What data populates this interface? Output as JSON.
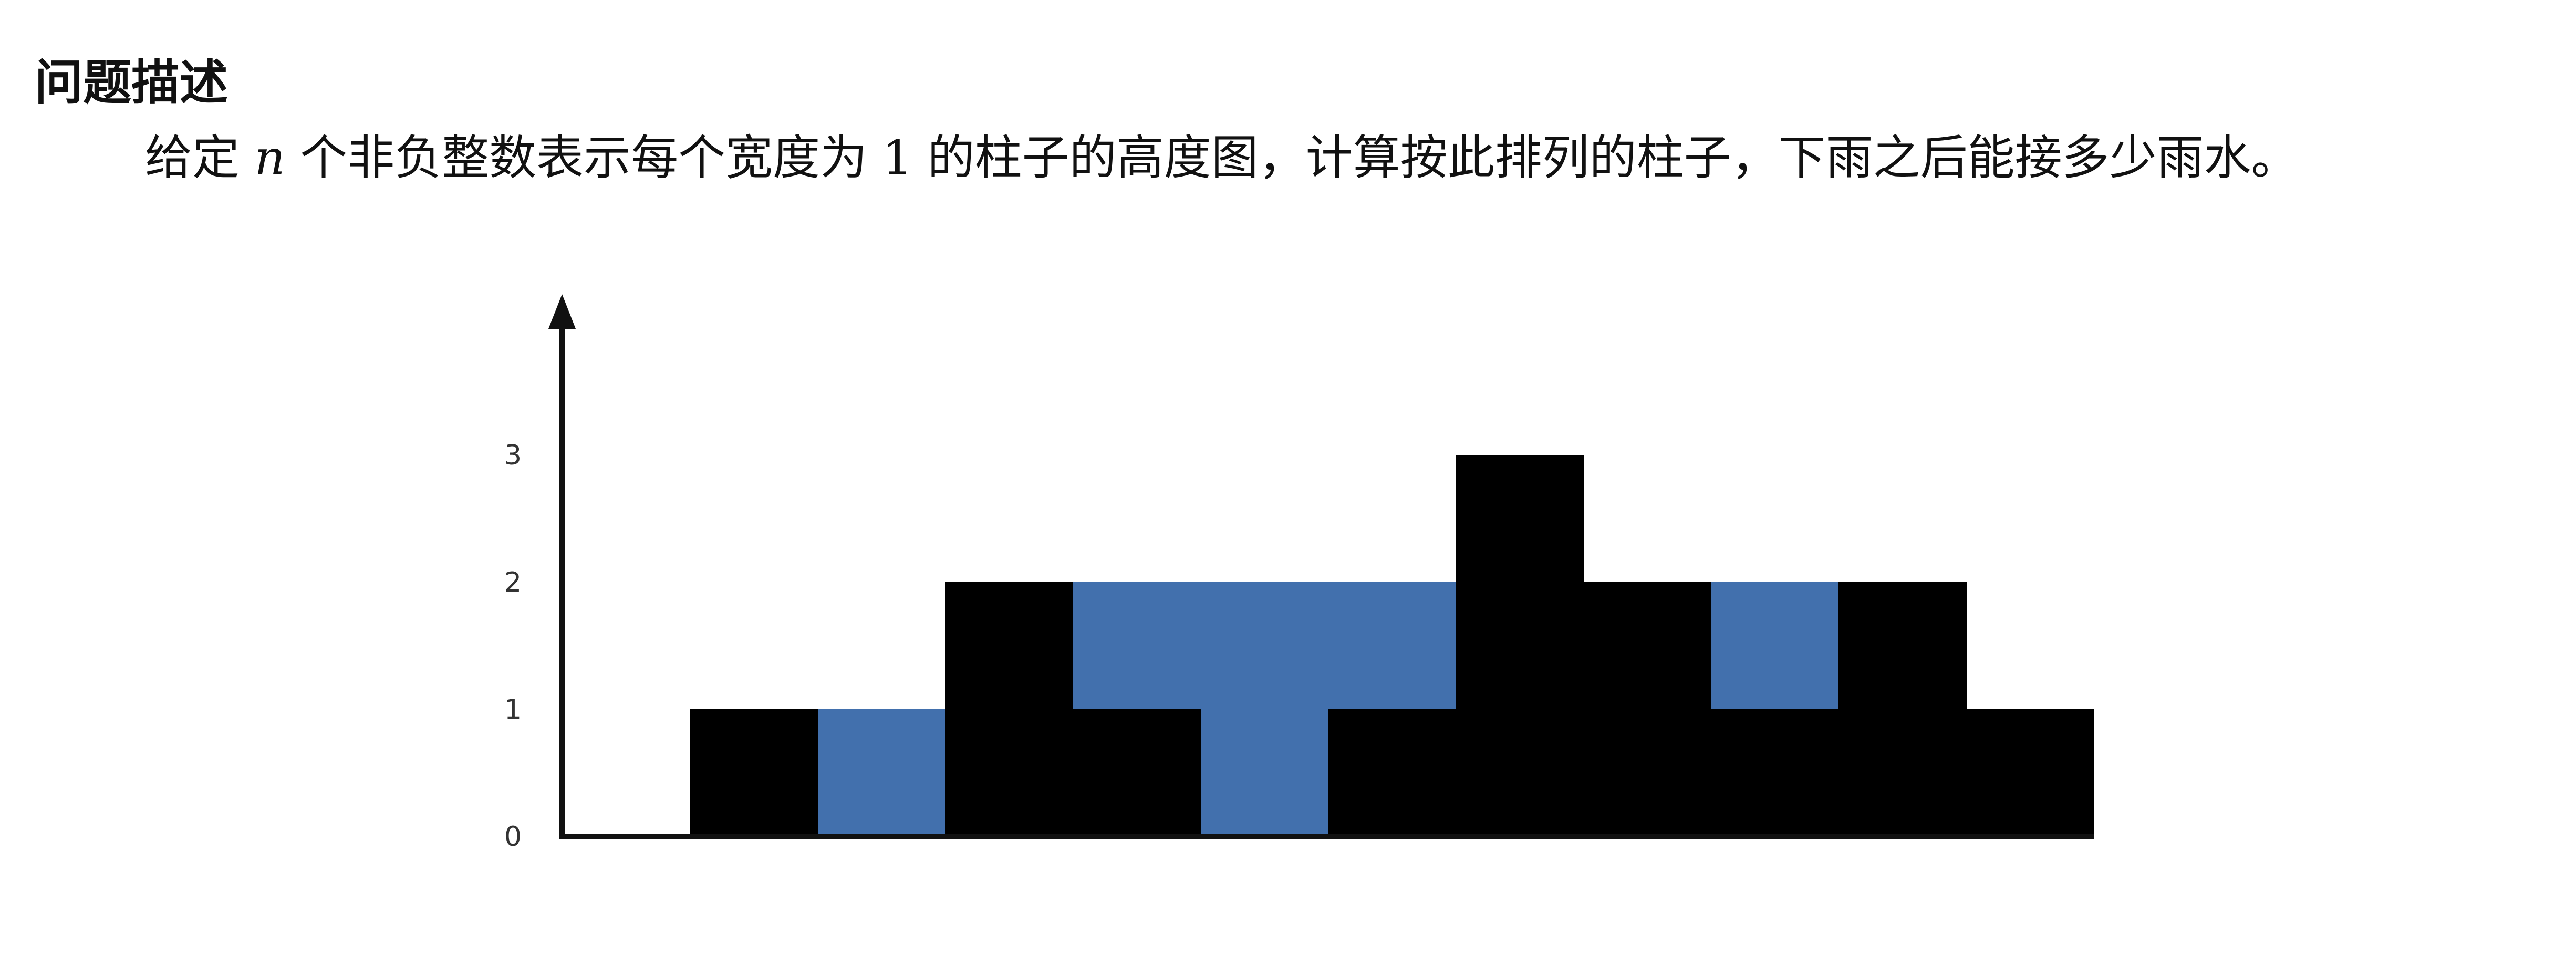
{
  "document": {
    "heading": "问题描述",
    "body": {
      "before_var": "给定 ",
      "var": "n",
      "after_var": " 个非负整数表示每个宽度为 1 的柱子的高度图，计算按此排列的柱子，下雨之后能接多少雨水。"
    }
  },
  "chart_data": {
    "type": "bar",
    "x": [
      0,
      1,
      2,
      3,
      4,
      5,
      6,
      7,
      8,
      9,
      10,
      11
    ],
    "yticks": [
      "0",
      "1",
      "2",
      "3"
    ],
    "ylim": [
      0,
      3
    ],
    "series": [
      {
        "values": [
          0,
          1,
          0,
          2,
          1,
          0,
          1,
          3,
          2,
          1,
          2,
          1
        ],
        "color": "#000000"
      },
      {
        "values": [
          0,
          0,
          1,
          0,
          1,
          2,
          1,
          0,
          0,
          1,
          0,
          0
        ],
        "color": "#4270ad"
      }
    ],
    "stacked": true,
    "axis_color": "#111111"
  }
}
